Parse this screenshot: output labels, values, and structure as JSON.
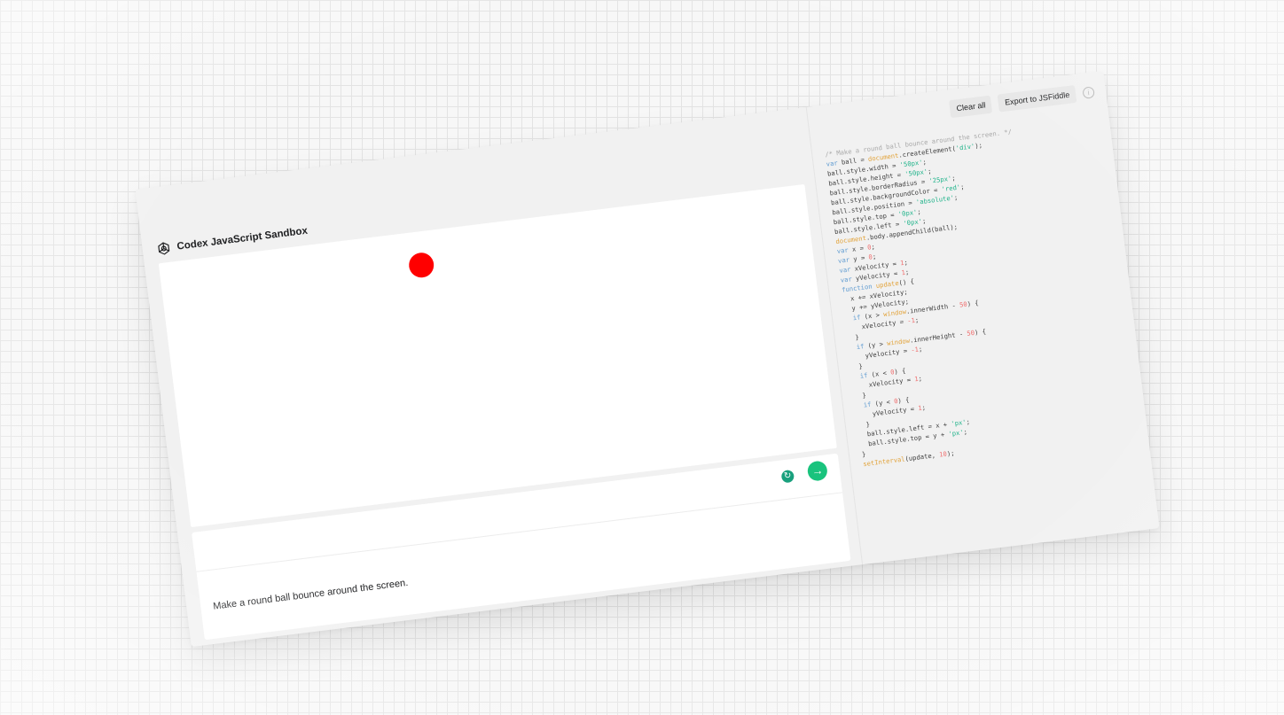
{
  "app": {
    "title": "Codex JavaScript Sandbox",
    "logo_icon": "openai-logo-icon"
  },
  "toolbar": {
    "clear_label": "Clear all",
    "export_label": "Export to JSFiddle",
    "info_icon": "info-icon"
  },
  "prompt": {
    "text": "Make a round ball bounce around the screen.",
    "retry_icon": "refresh-icon",
    "submit_icon": "arrow-right-icon"
  },
  "canvas": {
    "ball_color": "#ff0000"
  },
  "colors": {
    "accent": "#19c37d",
    "keyword": "#5f9bd1",
    "object": "#e2a33a",
    "string": "#1fb38a",
    "number": "#f06e6e",
    "comment": "#a9a9a9"
  },
  "code_lines": [
    [
      {
        "t": "/* Make a round ball bounce around the screen. */",
        "c": "comment"
      }
    ],
    [
      {
        "t": "var",
        "c": "kw"
      },
      {
        "t": " ball = "
      },
      {
        "t": "document",
        "c": "obj"
      },
      {
        "t": ".createElement("
      },
      {
        "t": "'div'",
        "c": "str"
      },
      {
        "t": ");"
      }
    ],
    [
      {
        "t": "ball.style.width = "
      },
      {
        "t": "'50px'",
        "c": "str"
      },
      {
        "t": ";"
      }
    ],
    [
      {
        "t": "ball.style.height = "
      },
      {
        "t": "'50px'",
        "c": "str"
      },
      {
        "t": ";"
      }
    ],
    [
      {
        "t": "ball.style.borderRadius = "
      },
      {
        "t": "'25px'",
        "c": "str"
      },
      {
        "t": ";"
      }
    ],
    [
      {
        "t": "ball.style.backgroundColor = "
      },
      {
        "t": "'red'",
        "c": "str"
      },
      {
        "t": ";"
      }
    ],
    [
      {
        "t": "ball.style.position = "
      },
      {
        "t": "'absolute'",
        "c": "str"
      },
      {
        "t": ";"
      }
    ],
    [
      {
        "t": "ball.style.top = "
      },
      {
        "t": "'0px'",
        "c": "str"
      },
      {
        "t": ";"
      }
    ],
    [
      {
        "t": "ball.style.left = "
      },
      {
        "t": "'0px'",
        "c": "str"
      },
      {
        "t": ";"
      }
    ],
    [
      {
        "t": "document",
        "c": "obj"
      },
      {
        "t": ".body.appendChild(ball);"
      }
    ],
    [
      {
        "t": "var",
        "c": "kw"
      },
      {
        "t": " x = "
      },
      {
        "t": "0",
        "c": "num"
      },
      {
        "t": ";"
      }
    ],
    [
      {
        "t": "var",
        "c": "kw"
      },
      {
        "t": " y = "
      },
      {
        "t": "0",
        "c": "num"
      },
      {
        "t": ";"
      }
    ],
    [
      {
        "t": "var",
        "c": "kw"
      },
      {
        "t": " xVelocity = "
      },
      {
        "t": "1",
        "c": "num"
      },
      {
        "t": ";"
      }
    ],
    [
      {
        "t": "var",
        "c": "kw"
      },
      {
        "t": " yVelocity = "
      },
      {
        "t": "1",
        "c": "num"
      },
      {
        "t": ";"
      }
    ],
    [
      {
        "t": "function",
        "c": "kw"
      },
      {
        "t": " "
      },
      {
        "t": "update",
        "c": "obj"
      },
      {
        "t": "() {"
      }
    ],
    [
      {
        "t": "  x += xVelocity;"
      }
    ],
    [
      {
        "t": "  y += yVelocity;"
      }
    ],
    [
      {
        "t": "  "
      },
      {
        "t": "if",
        "c": "kw"
      },
      {
        "t": " (x > "
      },
      {
        "t": "window",
        "c": "obj"
      },
      {
        "t": ".innerWidth - "
      },
      {
        "t": "50",
        "c": "num"
      },
      {
        "t": ") {"
      }
    ],
    [
      {
        "t": "    xVelocity = "
      },
      {
        "t": "-1",
        "c": "num"
      },
      {
        "t": ";"
      }
    ],
    [
      {
        "t": "  }"
      }
    ],
    [
      {
        "t": "  "
      },
      {
        "t": "if",
        "c": "kw"
      },
      {
        "t": " (y > "
      },
      {
        "t": "window",
        "c": "obj"
      },
      {
        "t": ".innerHeight - "
      },
      {
        "t": "50",
        "c": "num"
      },
      {
        "t": ") {"
      }
    ],
    [
      {
        "t": "    yVelocity = "
      },
      {
        "t": "-1",
        "c": "num"
      },
      {
        "t": ";"
      }
    ],
    [
      {
        "t": "  }"
      }
    ],
    [
      {
        "t": "  "
      },
      {
        "t": "if",
        "c": "kw"
      },
      {
        "t": " (x < "
      },
      {
        "t": "0",
        "c": "num"
      },
      {
        "t": ") {"
      }
    ],
    [
      {
        "t": "    xVelocity = "
      },
      {
        "t": "1",
        "c": "num"
      },
      {
        "t": ";"
      }
    ],
    [
      {
        "t": "  }"
      }
    ],
    [
      {
        "t": "  "
      },
      {
        "t": "if",
        "c": "kw"
      },
      {
        "t": " (y < "
      },
      {
        "t": "0",
        "c": "num"
      },
      {
        "t": ") {"
      }
    ],
    [
      {
        "t": "    yVelocity = "
      },
      {
        "t": "1",
        "c": "num"
      },
      {
        "t": ";"
      }
    ],
    [
      {
        "t": "  }"
      }
    ],
    [
      {
        "t": "  ball.style.left = x + "
      },
      {
        "t": "'px'",
        "c": "str"
      },
      {
        "t": ";"
      }
    ],
    [
      {
        "t": "  ball.style.top = y + "
      },
      {
        "t": "'px'",
        "c": "str"
      },
      {
        "t": ";"
      }
    ],
    [
      {
        "t": "}"
      }
    ],
    [
      {
        "t": "setInterval",
        "c": "obj"
      },
      {
        "t": "(update, "
      },
      {
        "t": "10",
        "c": "num"
      },
      {
        "t": ");"
      }
    ]
  ]
}
